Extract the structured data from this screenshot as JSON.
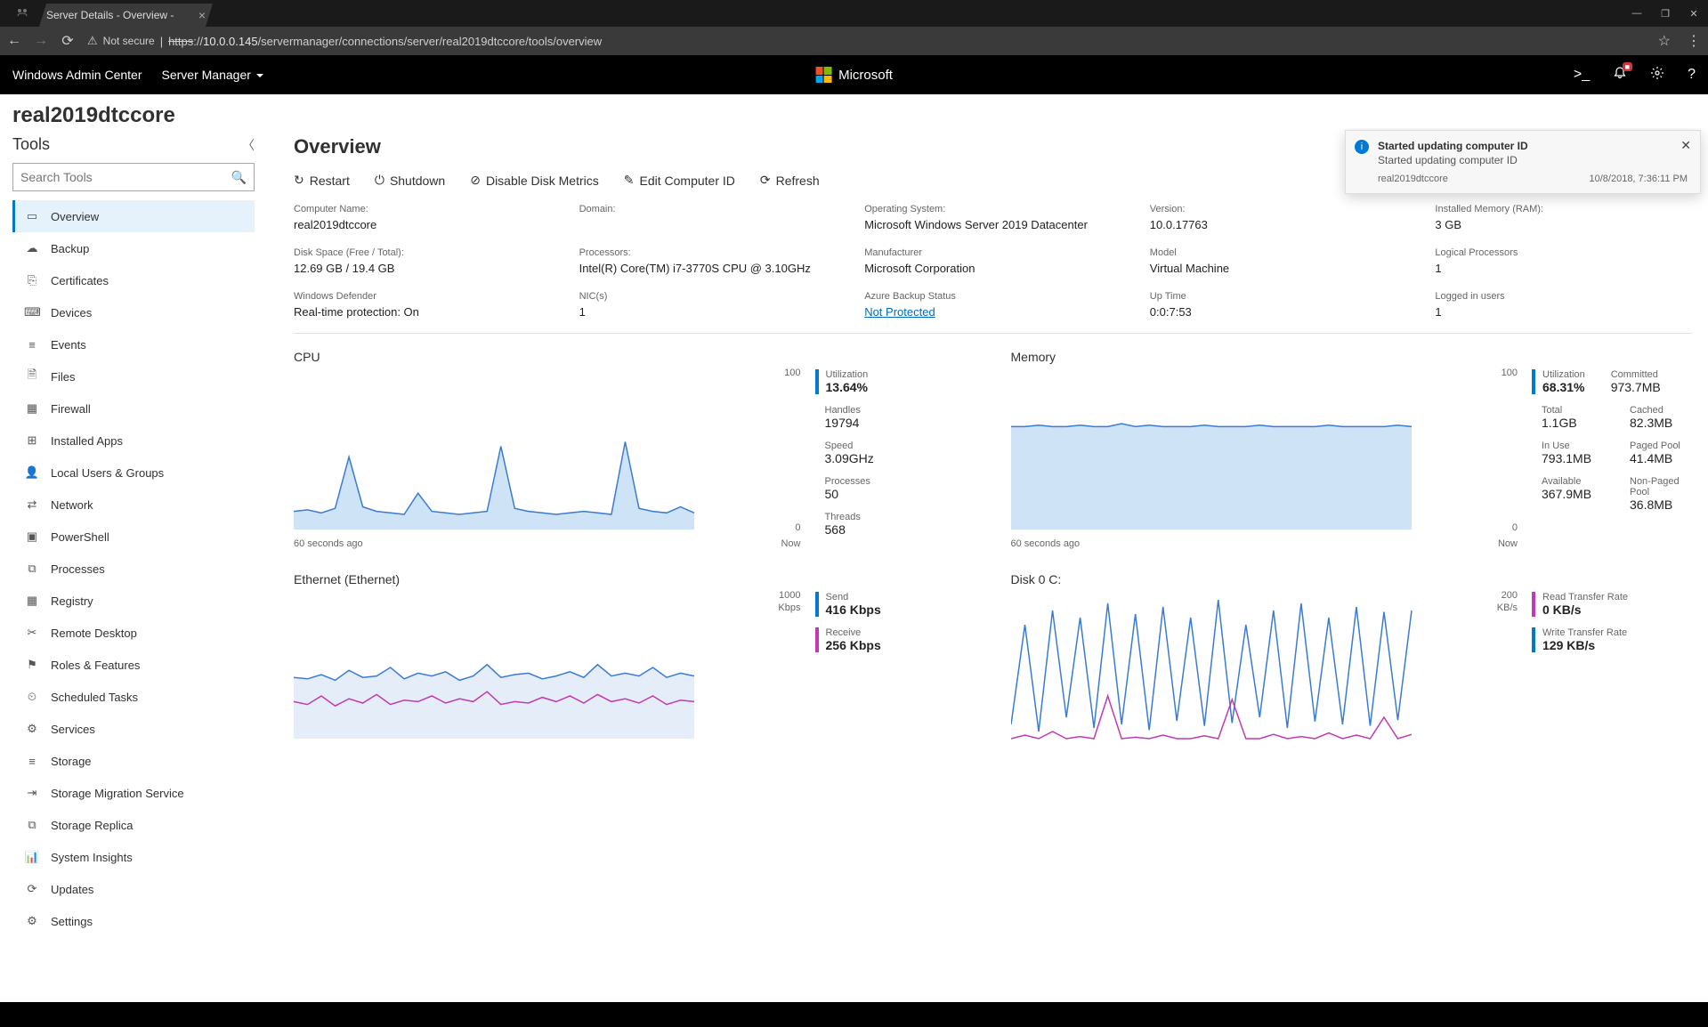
{
  "browser": {
    "tab_title": "Server Details - Overview - ",
    "secure_label": "Not secure",
    "url_display": "https://10.0.0.145/servermanager/connections/server/real2019dtccore/tools/overview"
  },
  "wac": {
    "product": "Windows Admin Center",
    "context": "Server Manager",
    "ms_label": "Microsoft",
    "bell_badge": "■"
  },
  "server_name": "real2019dtccore",
  "tools": {
    "header": "Tools",
    "search_placeholder": "Search Tools",
    "items": [
      {
        "icon": "▭",
        "label": "Overview",
        "selected": true
      },
      {
        "icon": "☁",
        "label": "Backup"
      },
      {
        "icon": "⎘",
        "label": "Certificates"
      },
      {
        "icon": "⌨",
        "label": "Devices"
      },
      {
        "icon": "≡",
        "label": "Events"
      },
      {
        "icon": "🗎",
        "label": "Files"
      },
      {
        "icon": "▦",
        "label": "Firewall"
      },
      {
        "icon": "⊞",
        "label": "Installed Apps"
      },
      {
        "icon": "👤",
        "label": "Local Users & Groups"
      },
      {
        "icon": "⇄",
        "label": "Network"
      },
      {
        "icon": "▣",
        "label": "PowerShell"
      },
      {
        "icon": "⧉",
        "label": "Processes"
      },
      {
        "icon": "▦",
        "label": "Registry"
      },
      {
        "icon": "✂",
        "label": "Remote Desktop"
      },
      {
        "icon": "⚑",
        "label": "Roles & Features"
      },
      {
        "icon": "⏲",
        "label": "Scheduled Tasks"
      },
      {
        "icon": "⚙",
        "label": "Services"
      },
      {
        "icon": "≡",
        "label": "Storage"
      },
      {
        "icon": "⇥",
        "label": "Storage Migration Service"
      },
      {
        "icon": "⧉",
        "label": "Storage Replica"
      },
      {
        "icon": "📊",
        "label": "System Insights"
      },
      {
        "icon": "⟳",
        "label": "Updates"
      },
      {
        "icon": "⚙",
        "label": "Settings"
      }
    ]
  },
  "overview": {
    "title": "Overview",
    "actions": {
      "restart": "Restart",
      "shutdown": "Shutdown",
      "disable_disk": "Disable Disk Metrics",
      "edit_id": "Edit Computer ID",
      "refresh": "Refresh"
    },
    "props": [
      {
        "label": "Computer Name:",
        "value": "real2019dtccore"
      },
      {
        "label": "Domain:",
        "value": ""
      },
      {
        "label": "Operating System:",
        "value": "Microsoft Windows Server 2019 Datacenter"
      },
      {
        "label": "Version:",
        "value": "10.0.17763"
      },
      {
        "label": "Installed Memory (RAM):",
        "value": "3 GB"
      },
      {
        "label": "Disk Space (Free / Total):",
        "value": "12.69 GB / 19.4 GB"
      },
      {
        "label": "Processors:",
        "value": "Intel(R) Core(TM) i7-3770S CPU @ 3.10GHz"
      },
      {
        "label": "Manufacturer",
        "value": "Microsoft Corporation"
      },
      {
        "label": "Model",
        "value": "Virtual Machine"
      },
      {
        "label": "Logical Processors",
        "value": "1"
      },
      {
        "label": "Windows Defender",
        "value": "Real-time protection: On"
      },
      {
        "label": "NIC(s)",
        "value": "1"
      },
      {
        "label": "Azure Backup Status",
        "value": "Not Protected",
        "link": true
      },
      {
        "label": "Up Time",
        "value": "0:0:7:53"
      },
      {
        "label": "Logged in users",
        "value": "1"
      }
    ]
  },
  "metrics": {
    "cpu": {
      "title": "CPU",
      "x_left": "60 seconds ago",
      "x_right": "Now",
      "ymax": "100",
      "ymin": "0",
      "stats": [
        {
          "label": "Utilization",
          "value": "13.64%",
          "big": true,
          "bar": "green"
        },
        {
          "label": "Handles",
          "value": "19794"
        },
        {
          "label": "Speed",
          "value": "3.09GHz"
        },
        {
          "label": "Processes",
          "value": "50"
        },
        {
          "label": "Threads",
          "value": "568"
        }
      ]
    },
    "memory": {
      "title": "Memory",
      "x_left": "60 seconds ago",
      "x_right": "Now",
      "ymax": "100",
      "ymin": "0",
      "stats": [
        {
          "label": "Utilization",
          "value": "68.31%",
          "big": true,
          "bar": "green"
        },
        {
          "label": "Committed",
          "value": "973.7MB"
        },
        {
          "label": "Total",
          "value": "1.1GB"
        },
        {
          "label": "Cached",
          "value": "82.3MB"
        },
        {
          "label": "In Use",
          "value": "793.1MB"
        },
        {
          "label": "Paged Pool",
          "value": "41.4MB"
        },
        {
          "label": "Available",
          "value": "367.9MB"
        },
        {
          "label": "Non-Paged Pool",
          "value": "36.8MB"
        }
      ]
    },
    "ethernet": {
      "title": "Ethernet (Ethernet)",
      "ymax": "1000",
      "yunit": "Kbps",
      "stats": [
        {
          "label": "Send",
          "value": "416 Kbps",
          "big": true,
          "bar": "green"
        },
        {
          "label": "Receive",
          "value": "256 Kbps",
          "big": true,
          "bar": "mag"
        }
      ]
    },
    "disk": {
      "title": "Disk 0 C:",
      "ymax": "200",
      "yunit": "KB/s",
      "stats": [
        {
          "label": "Read Transfer Rate",
          "value": "0 KB/s",
          "big": true,
          "bar": "mag"
        },
        {
          "label": "Write Transfer Rate",
          "value": "129 KB/s",
          "big": true,
          "bar": "green"
        }
      ]
    }
  },
  "toast": {
    "title": "Started updating computer ID",
    "subtitle": "Started updating computer ID",
    "source": "real2019dtccore",
    "time": "10/8/2018, 7:36:11 PM"
  },
  "chart_data": [
    {
      "type": "area",
      "name": "CPU",
      "ylim": [
        0,
        100
      ],
      "xrange": "60s",
      "values": [
        12,
        13,
        11,
        14,
        48,
        15,
        12,
        11,
        10,
        24,
        12,
        11,
        10,
        11,
        12,
        55,
        14,
        12,
        11,
        10,
        11,
        12,
        11,
        10,
        58,
        14,
        12,
        11,
        15,
        11
      ]
    },
    {
      "type": "area",
      "name": "Memory",
      "ylim": [
        0,
        100
      ],
      "xrange": "60s",
      "values": [
        68,
        68,
        69,
        68,
        68,
        69,
        68,
        68,
        70,
        68,
        69,
        68,
        68,
        68,
        69,
        68,
        68,
        68,
        69,
        68,
        68,
        68,
        68,
        69,
        68,
        68,
        68,
        68,
        69,
        68
      ]
    },
    {
      "type": "line",
      "name": "Ethernet",
      "ylim": [
        0,
        1000
      ],
      "xrange": "60s",
      "unit": "Kbps",
      "series": [
        {
          "name": "Send",
          "values": [
            430,
            420,
            450,
            410,
            480,
            430,
            440,
            500,
            420,
            460,
            440,
            470,
            410,
            440,
            520,
            430,
            450,
            460,
            420,
            440,
            470,
            430,
            520,
            440,
            460,
            440,
            500,
            430,
            460,
            440
          ]
        },
        {
          "name": "Receive",
          "values": [
            260,
            240,
            300,
            230,
            280,
            250,
            310,
            240,
            270,
            260,
            300,
            250,
            280,
            260,
            330,
            240,
            260,
            250,
            290,
            260,
            300,
            250,
            310,
            260,
            280,
            250,
            300,
            240,
            270,
            260
          ]
        }
      ]
    },
    {
      "type": "line",
      "name": "Disk",
      "ylim": [
        0,
        200
      ],
      "xrange": "60s",
      "unit": "KB/s",
      "series": [
        {
          "name": "Write",
          "values": [
            20,
            160,
            10,
            180,
            30,
            170,
            15,
            190,
            20,
            175,
            12,
            185,
            25,
            170,
            18,
            195,
            22,
            160,
            30,
            180,
            15,
            190,
            24,
            170,
            20,
            185,
            18,
            178,
            26,
            180
          ]
        },
        {
          "name": "Read",
          "values": [
            0,
            5,
            0,
            10,
            0,
            3,
            0,
            60,
            0,
            2,
            0,
            5,
            0,
            0,
            4,
            0,
            55,
            0,
            0,
            6,
            0,
            3,
            0,
            8,
            0,
            5,
            0,
            30,
            0,
            6
          ]
        }
      ]
    }
  ]
}
